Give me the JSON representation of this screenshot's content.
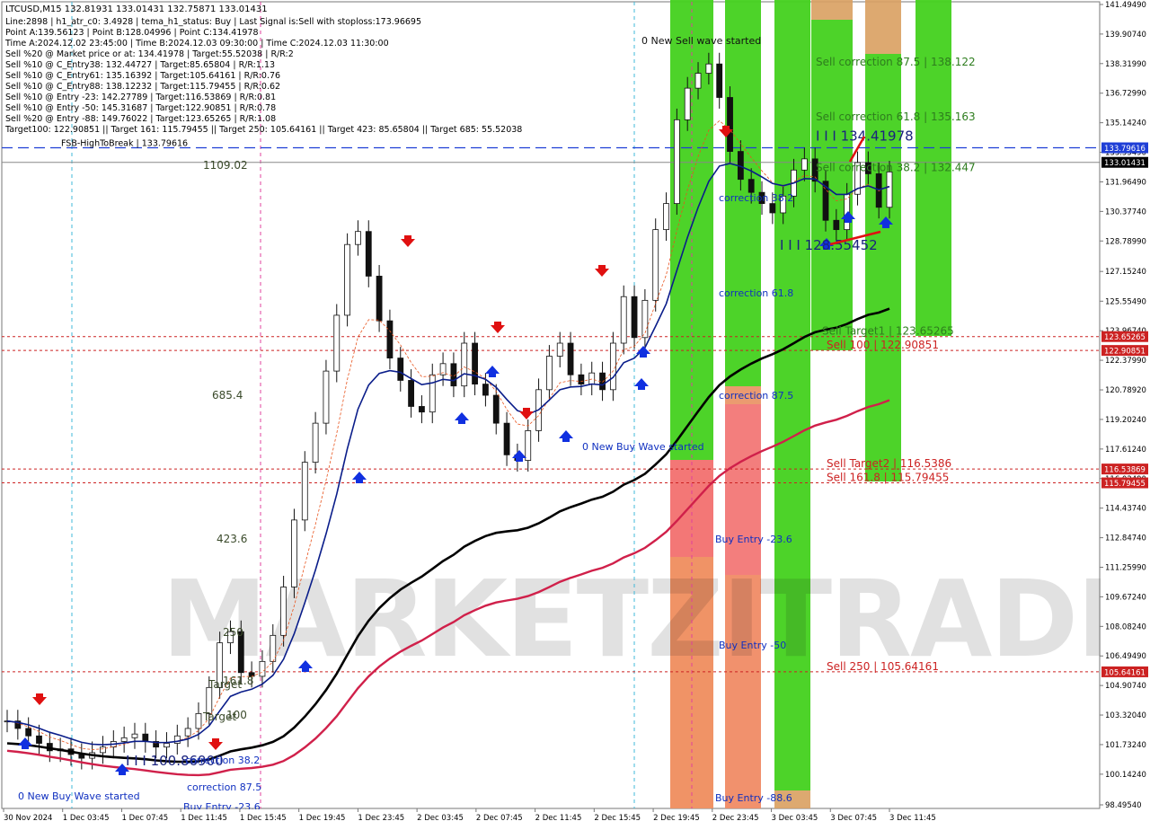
{
  "header": {
    "symbol_line": "LTCUSD,M15  132.81931 133.01431 132.75871 133.01431",
    "info_lines": [
      "Line:2898 | h1_atr_c0: 3.4928 | tema_h1_status: Buy | Last Signal is:Sell with stoploss:173.96695",
      "Point A:139.56123 | Point B:128.04996 | Point C:134.41978",
      "Time A:2024.12.02 23:45:00 | Time B:2024.12.03 09:30:00 | Time C:2024.12.03 11:30:00",
      "Sell %20 @ Market price or at: 134.41978 | Target:55.52038 | R/R:2",
      "Sell %10 @ C_Entry38: 132.44727 | Target:85.65804 | R/R:1.13",
      "Sell %10 @ C_Entry61: 135.16392 | Target:105.64161 | R/R:0.76",
      "Sell %10 @ C_Entry88: 138.12232 | Target:115.79455 | R/R:0.62",
      "Sell %10 @ Entry -23: 142.27789 | Target:116.53869 | R/R:0.81",
      "Sell %10 @ Entry -50: 145.31687 | Target:122.90851 | R/R:0.78",
      "Sell %20 @ Entry -88: 149.76022 | Target:123.65265 | R/R:1.08",
      "Target100: 122.90851 || Target 161: 115.79455 || Target 250: 105.64161 || Target 423: 85.65804 || Target 685: 55.52038"
    ]
  },
  "watermark": "MARKETZITRADE",
  "chart_data": {
    "type": "candlestick",
    "symbol": "LTCUSD",
    "timeframe": "M15",
    "ylim": [
      98.4954,
      141.4949
    ],
    "y_ticks": [
      "141.49490",
      "139.90740",
      "138.31990",
      "136.72990",
      "135.14240",
      "133.55490",
      "131.96490",
      "130.37740",
      "128.78990",
      "127.15240",
      "125.55490",
      "123.96740",
      "122.37990",
      "120.78920",
      "119.20240",
      "117.61240",
      "116.02490",
      "114.43740",
      "112.84740",
      "111.25990",
      "109.67240",
      "108.08240",
      "106.49490",
      "104.90740",
      "103.32040",
      "101.73240",
      "100.14240",
      "98.49540"
    ],
    "x_ticks": [
      "30 Nov 2024",
      "1 Dec 03:45",
      "1 Dec 07:45",
      "1 Dec 11:45",
      "1 Dec 15:45",
      "1 Dec 19:45",
      "1 Dec 23:45",
      "2 Dec 03:45",
      "2 Dec 07:45",
      "2 Dec 11:45",
      "2 Dec 15:45",
      "2 Dec 19:45",
      "2 Dec 23:45",
      "3 Dec 03:45",
      "3 Dec 07:45",
      "3 Dec 11:45"
    ],
    "price_tags": [
      {
        "label": "133.79616",
        "price": 133.79616,
        "color": "#1f3fd6"
      },
      {
        "label": "133.01431",
        "price": 133.01431,
        "color": "#000000"
      },
      {
        "label": "123.65265",
        "price": 123.65265,
        "color": "#cc2222"
      },
      {
        "label": "122.90851",
        "price": 122.90851,
        "color": "#cc2222"
      },
      {
        "label": "116.53869",
        "price": 116.53869,
        "color": "#cc2222"
      },
      {
        "label": "115.79455",
        "price": 115.79455,
        "color": "#cc2222"
      },
      {
        "label": "105.64161",
        "price": 105.64161,
        "color": "#cc2222"
      }
    ],
    "fsb_line": {
      "label": "FSB-HighToBreak | 133.79616",
      "price": 133.79616
    },
    "level_annotations": [
      {
        "text": "Sell correction 87.5 | 138.122",
        "price": 138.122,
        "color": "#2e7d1e"
      },
      {
        "text": "Sell correction 61.8 | 135.163",
        "price": 135.163,
        "color": "#2e7d1e"
      },
      {
        "text": "Sell correction 38.2 | 132.447",
        "price": 132.447,
        "color": "#2e7d1e"
      },
      {
        "text": "Sell Target1 | 123.65265",
        "price": 123.65265,
        "color": "#2e7d1e"
      },
      {
        "text": "Sell 100 | 122.90851",
        "price": 122.90851,
        "color": "#cc2222"
      },
      {
        "text": "Sell Target2 | 116.5386",
        "price": 116.5386,
        "color": "#cc2222"
      },
      {
        "text": "Sell 161.8 | 115.79455",
        "price": 115.79455,
        "color": "#cc2222"
      },
      {
        "text": "Sell 250 | 105.64161",
        "price": 105.64161,
        "color": "#cc2222"
      }
    ],
    "point_labels": [
      {
        "text": "I I I 134.41978",
        "price": 134.41978,
        "color": "#1a237e"
      },
      {
        "text": "I I I 128.55452",
        "price": 128.55452,
        "color": "#1a237e"
      },
      {
        "text": "I I I 100.86900",
        "price": 100.869,
        "color": "#1a237e"
      }
    ],
    "left_scale_labels": [
      "1109.02",
      "685.4",
      "423.6",
      "250",
      "161.8",
      "100",
      "Target",
      "Target"
    ],
    "zone_labels": [
      "correction 38.2",
      "correction 61.8",
      "correction 87.5",
      "Buy Entry -23.6",
      "Buy Entry -50",
      "Buy Entry -88.6",
      "correction 38.2",
      "correction 87.5",
      "Buy Entry -23.6"
    ],
    "wave_labels": [
      "0 New Sell wave started",
      "0 New Buy Wave started",
      "0 New Buy Wave started"
    ],
    "series": [
      {
        "name": "close",
        "values": [
          103.0,
          102.6,
          102.2,
          101.8,
          101.4,
          101.5,
          101.2,
          101.0,
          101.3,
          101.6,
          101.9,
          102.1,
          102.3,
          101.9,
          101.6,
          101.8,
          102.2,
          102.6,
          103.4,
          104.8,
          107.2,
          107.8,
          105.6,
          105.4,
          106.2,
          107.6,
          110.2,
          113.8,
          116.9,
          119.0,
          121.8,
          124.8,
          128.6,
          129.3,
          126.9,
          124.5,
          122.5,
          121.3,
          119.9,
          119.6,
          121.6,
          122.2,
          121.0,
          123.3,
          121.1,
          120.5,
          119.0,
          117.3,
          117.0,
          118.6,
          120.8,
          122.6,
          123.3,
          121.6,
          121.1,
          121.7,
          120.8,
          123.3,
          125.8,
          123.6,
          125.6,
          129.4,
          130.8,
          135.3,
          137.0,
          137.8,
          138.3,
          136.5,
          133.6,
          132.1,
          131.4,
          130.8,
          130.3,
          131.2,
          132.6,
          133.2,
          132.0,
          129.9,
          129.4,
          131.3,
          133.0,
          132.4,
          130.6,
          132.5
        ]
      }
    ]
  }
}
